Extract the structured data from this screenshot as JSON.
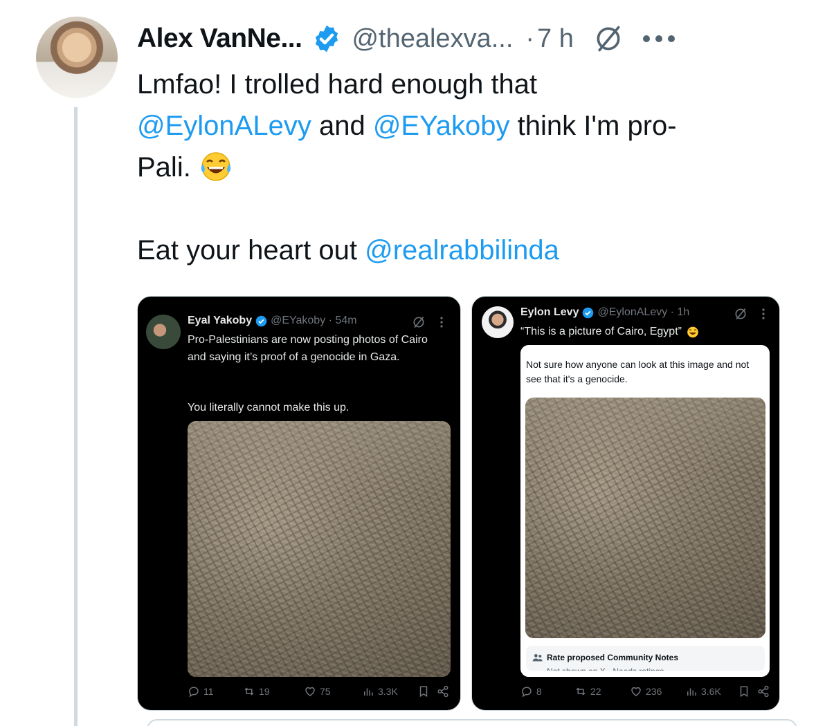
{
  "tweet": {
    "author_name": "Alex VanNe...",
    "author_handle": "@thealexva...",
    "separator": "·",
    "time": "7 h",
    "text": {
      "line1": "Lmfao! I trolled hard enough that",
      "mention1": "@EylonALevy",
      "and": " and ",
      "mention2": "@EYakoby",
      "line2_tail": " think I'm pro-",
      "line3": "Pali. ",
      "line5": "Eat your heart out ",
      "mention3": "@realrabbilinda"
    }
  },
  "screenshots": {
    "left": {
      "name": "Eyal Yakoby",
      "meta": "@EYakoby · 54m",
      "text1": "Pro-Palestinians are now posting photos of Cairo and saying it’s proof of a genocide in Gaza.",
      "text2": "You literally cannot make this up.",
      "replies": "11",
      "reposts": "19",
      "likes": "75",
      "views": "3.3K"
    },
    "right": {
      "name": "Eylon Levy",
      "meta": "@EylonALevy · 1h",
      "text": "“This is a picture of Cairo, Egypt”",
      "quote_text": "Not sure how anyone can look at this image and not see that it's a genocide.",
      "community_notes": "Rate proposed Community Notes",
      "community_sub": "Not shown on X · Needs ratings",
      "replies": "8",
      "reposts": "22",
      "likes": "236",
      "views": "3.6K"
    }
  },
  "colors": {
    "link": "#1d9bf0",
    "verified": "#1d9bf0",
    "muted": "#536471",
    "card_bg": "#000000"
  }
}
